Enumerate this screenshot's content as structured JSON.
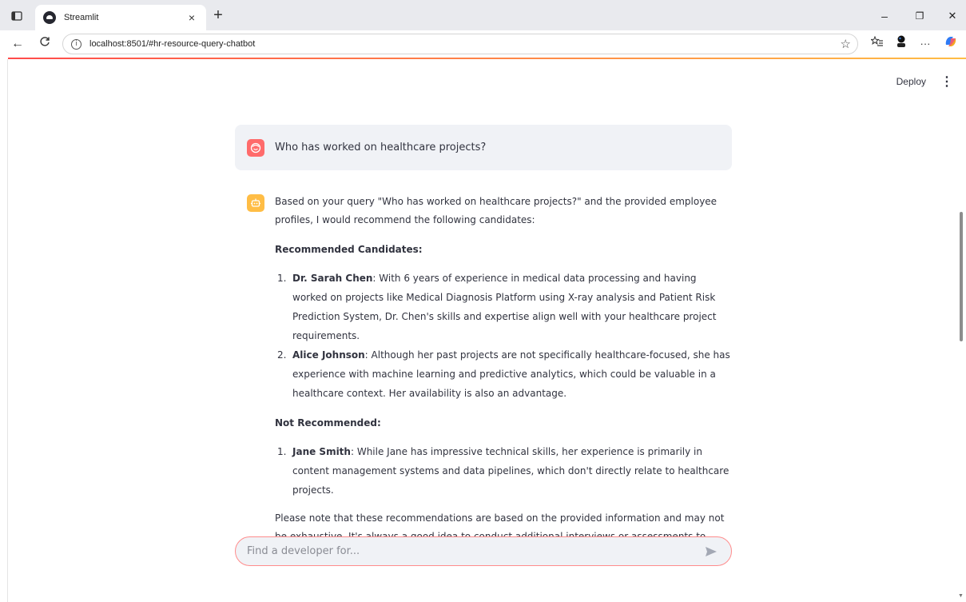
{
  "browser": {
    "tab_title": "Streamlit",
    "tab_close": "×",
    "new_tab": "+",
    "url": "localhost:8501/#hr-resource-query-chatbot",
    "info": "i",
    "star": "☆",
    "caption": {
      "minimize": "–",
      "restore": "❐",
      "close": "✕"
    },
    "nav": {
      "back": "←",
      "reload": "C",
      "more": "···"
    }
  },
  "header": {
    "deploy_label": "Deploy",
    "menu_glyph": "⋮"
  },
  "chat": {
    "user_message": "Who has worked on healthcare projects?",
    "bot": {
      "intro": "Based on your query \"Who has worked on healthcare projects?\" and the provided employee profiles, I would recommend the following candidates:",
      "recommended_heading": "Recommended Candidates:",
      "recommended": [
        {
          "num": "1.",
          "name": "Dr. Sarah Chen",
          "text": ": With 6 years of experience in medical data processing and having worked on projects like Medical Diagnosis Platform using X-ray analysis and Patient Risk Prediction System, Dr. Chen's skills and expertise align well with your healthcare project requirements."
        },
        {
          "num": "2.",
          "name": "Alice Johnson",
          "text": ": Although her past projects are not specifically healthcare-focused, she has experience with machine learning and predictive analytics, which could be valuable in a healthcare context. Her availability is also an advantage."
        }
      ],
      "not_recommended_heading": "Not Recommended:",
      "not_recommended": [
        {
          "num": "1.",
          "name": "Jane Smith",
          "text": ": While Jane has impressive technical skills, her experience is primarily in content management systems and data pipelines, which don't directly relate to healthcare projects."
        }
      ],
      "closing": "Please note that these recommendations are based on the provided information and may not be exhaustive. It's always a good idea to conduct additional interviews or assessments to ensure the best fit for your project."
    }
  },
  "input": {
    "placeholder": "Find a developer for..."
  },
  "colors": {
    "accent": "#ff4b4b",
    "user_avatar": "#ff6b6b",
    "bot_avatar": "#ffbd45",
    "message_bg": "#f0f2f6"
  }
}
